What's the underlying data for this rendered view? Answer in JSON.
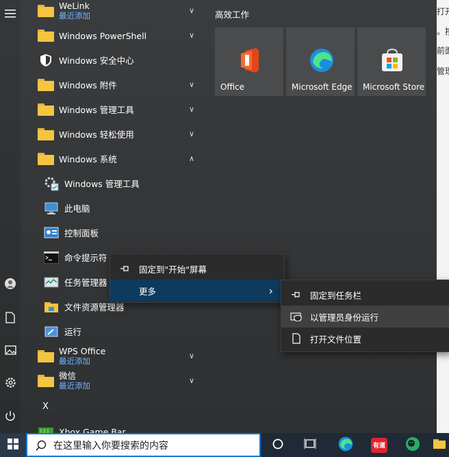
{
  "background_window": {
    "lines": [
      "打开",
      "。按",
      "前面",
      "管理"
    ]
  },
  "app_list": [
    {
      "label": "WeLink",
      "sub": "最近添加",
      "icon": "folder-icon",
      "chevron": "∨"
    },
    {
      "label": "Windows PowerShell",
      "sub": "",
      "icon": "folder-icon",
      "chevron": "∨"
    },
    {
      "label": "Windows 安全中心",
      "sub": "",
      "icon": "shield-icon",
      "chevron": ""
    },
    {
      "label": "Windows 附件",
      "sub": "",
      "icon": "folder-icon",
      "chevron": "∨"
    },
    {
      "label": "Windows 管理工具",
      "sub": "",
      "icon": "folder-icon",
      "chevron": "∨"
    },
    {
      "label": "Windows 轻松使用",
      "sub": "",
      "icon": "folder-icon",
      "chevron": "∨"
    },
    {
      "label": "Windows 系统",
      "sub": "",
      "icon": "folder-icon",
      "chevron": "∧"
    },
    {
      "label": "Windows 管理工具",
      "sub": "",
      "icon": "admin-tools-icon",
      "chevron": ""
    },
    {
      "label": "此电脑",
      "sub": "",
      "icon": "computer-icon",
      "chevron": ""
    },
    {
      "label": "控制面板",
      "sub": "",
      "icon": "control-panel-icon",
      "chevron": ""
    },
    {
      "label": "命令提示符",
      "sub": "",
      "icon": "cmd-icon",
      "chevron": ""
    },
    {
      "label": "任务管理器",
      "sub": "",
      "icon": "task-manager-icon",
      "chevron": ""
    },
    {
      "label": "文件资源管理器",
      "sub": "",
      "icon": "file-explorer-icon",
      "chevron": ""
    },
    {
      "label": "运行",
      "sub": "",
      "icon": "run-icon",
      "chevron": ""
    },
    {
      "label": "WPS Office",
      "sub": "最近添加",
      "icon": "folder-icon",
      "chevron": "∨"
    },
    {
      "label": "微信",
      "sub": "最近添加",
      "icon": "folder-icon",
      "chevron": "∨"
    }
  ],
  "letter_header": "X",
  "partial_app": "Xbox Game Bar",
  "tiles": {
    "group_title": "高效工作",
    "items": [
      {
        "label": "Office",
        "icon": "office-icon"
      },
      {
        "label": "Microsoft Edge",
        "icon": "edge-icon"
      },
      {
        "label": "Microsoft Store",
        "icon": "store-icon"
      }
    ]
  },
  "context_menu": {
    "items": [
      {
        "label": "固定到\"开始\"屏幕",
        "icon": "pin-icon"
      },
      {
        "label": "更多",
        "icon": "",
        "arrow": "›"
      }
    ]
  },
  "submenu": {
    "items": [
      {
        "label": "固定到任务栏",
        "icon": "pin-icon"
      },
      {
        "label": "以管理员身份运行",
        "icon": "shield-admin-icon"
      },
      {
        "label": "打开文件位置",
        "icon": "document-icon"
      }
    ]
  },
  "rail_icons": [
    "menu-icon",
    "user-icon",
    "document-icon",
    "pictures-icon",
    "settings-icon",
    "power-icon"
  ],
  "taskbar": {
    "search_placeholder": "在这里输入你要搜索的内容",
    "youdao_label": "有道"
  },
  "colors": {
    "accent": "#0078d7",
    "folder": "#f5c542",
    "subtext": "#6fb7ff",
    "menu_highlight": "#0e3a5e"
  }
}
